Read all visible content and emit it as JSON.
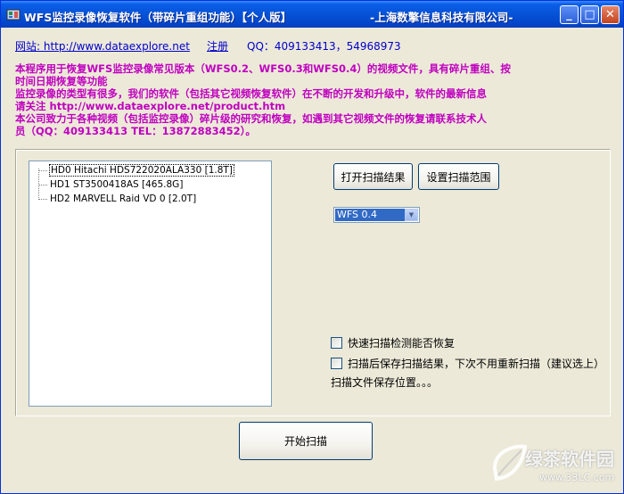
{
  "window": {
    "title": "WFS监控录像恢复软件（带碎片重组功能）【个人版】",
    "company": "-上海数擎信息科技有限公司-",
    "min_label": "_",
    "max_label": "□",
    "close_label": "✕"
  },
  "header": {
    "website_link": "网站: http://www.dataexplore.net",
    "register_link": "注册",
    "qq": "QQ：409133413，54968973"
  },
  "description": {
    "lines": [
      "本程序用于恢复WFS监控录像常见版本（WFS0.2、WFS0.3和WFS0.4）的视频文件，具有碎片重组、按",
      "时间日期恢复等功能",
      "监控录像的类型有很多，我们的软件（包括其它视频恢复软件）在不断的开发和升级中，软件的最新信息",
      "请关注 http://www.dataexplore.net/product.htm",
      "本公司致力于各种视频（包括监控录像）碎片级的研究和恢复，如遇到其它视频文件的恢复请联系技术人",
      "员（QQ：409133413 TEL：13872883452）。"
    ]
  },
  "disk_tree": {
    "items": [
      {
        "label": "HD0  Hitachi HDS722020ALA330  [1.8T]"
      },
      {
        "label": "HD1  ST3500418AS  [465.8G]"
      },
      {
        "label": "HD2  MARVELL Raid VD 0  [2.0T]"
      }
    ]
  },
  "buttons": {
    "open_scan_result": "打开扫描结果",
    "set_scan_range": "设置扫描范围",
    "start_scan": "开始扫描"
  },
  "version_select": {
    "selected": "WFS 0.4",
    "arrow": "▼"
  },
  "options": {
    "quick_scan": "快速扫描检测能否恢复",
    "save_after_scan": "扫描后保存扫描结果，下次不用重新扫描（建议选上）",
    "save_location": "扫描文件保存位置。。。"
  },
  "watermark": {
    "text": "绿茶软件园",
    "url": "www.33LC.com"
  },
  "colors": {
    "title_bar": "#0652D6",
    "description_text": "#C000C0",
    "link_text": "#0000CC",
    "selection": "#316AC5"
  }
}
